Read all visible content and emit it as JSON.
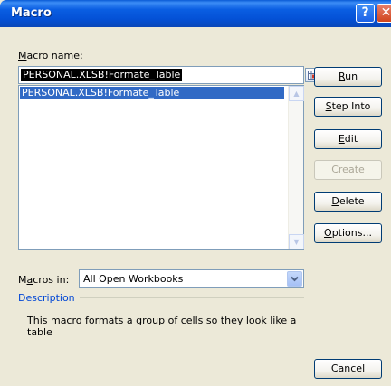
{
  "window": {
    "title": "Macro",
    "help_glyph": "?",
    "close_glyph": "✕"
  },
  "macro_name": {
    "label_u": "M",
    "label_rest": "acro name:",
    "value": "PERSONAL.XLSB!Formate_Table"
  },
  "macro_list": {
    "items": [
      "PERSONAL.XLSB!Formate_Table"
    ]
  },
  "buttons": {
    "run": {
      "u": "R",
      "rest": "un"
    },
    "step_into": {
      "u": "S",
      "rest": "tep Into"
    },
    "edit": {
      "u": "E",
      "rest": "dit"
    },
    "create": {
      "label": "Create"
    },
    "delete": {
      "u": "D",
      "rest": "elete"
    },
    "options": {
      "u": "O",
      "rest": "ptions..."
    },
    "cancel": {
      "label": "Cancel"
    }
  },
  "macros_in": {
    "label_pre": "M",
    "label_u": "a",
    "label_rest": "cros in:",
    "value": "All Open Workbooks"
  },
  "description": {
    "heading": "Description",
    "text": "This macro formats a group of cells so they look like a table"
  },
  "colors": {
    "title_bar": "#0a5ee2",
    "selection": "#316ac5",
    "dialog_bg": "#ece9d8",
    "description_heading": "#0046d5"
  },
  "icons": [
    "help-icon",
    "close-icon",
    "cell-picker-icon",
    "scroll-up-icon",
    "scroll-down-icon",
    "dropdown-arrow-icon"
  ]
}
